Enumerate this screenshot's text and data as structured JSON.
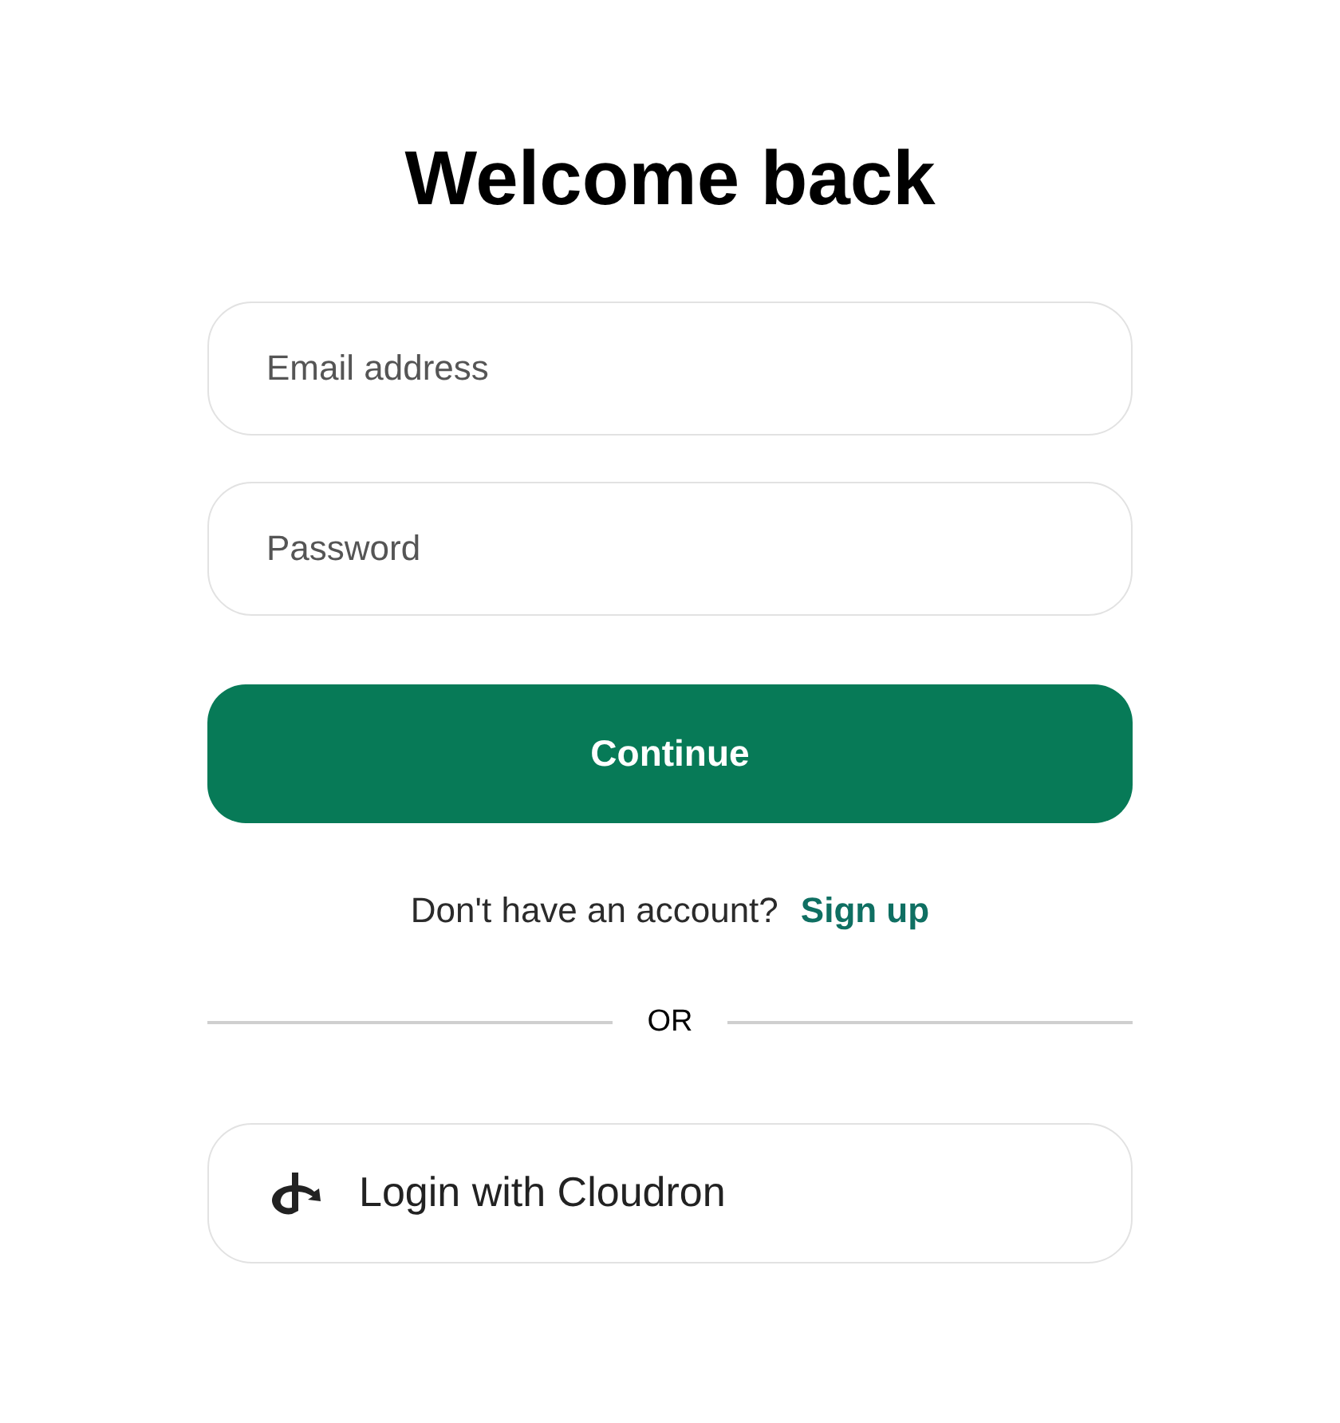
{
  "title": "Welcome back",
  "fields": [
    {
      "placeholder": "Email address"
    },
    {
      "placeholder": "Password"
    }
  ],
  "continue_button": "Continue",
  "signup_prompt": {
    "text": "Don't have an account?",
    "link": "Sign up"
  },
  "divider": "OR",
  "sso_button": "Login with Cloudron"
}
